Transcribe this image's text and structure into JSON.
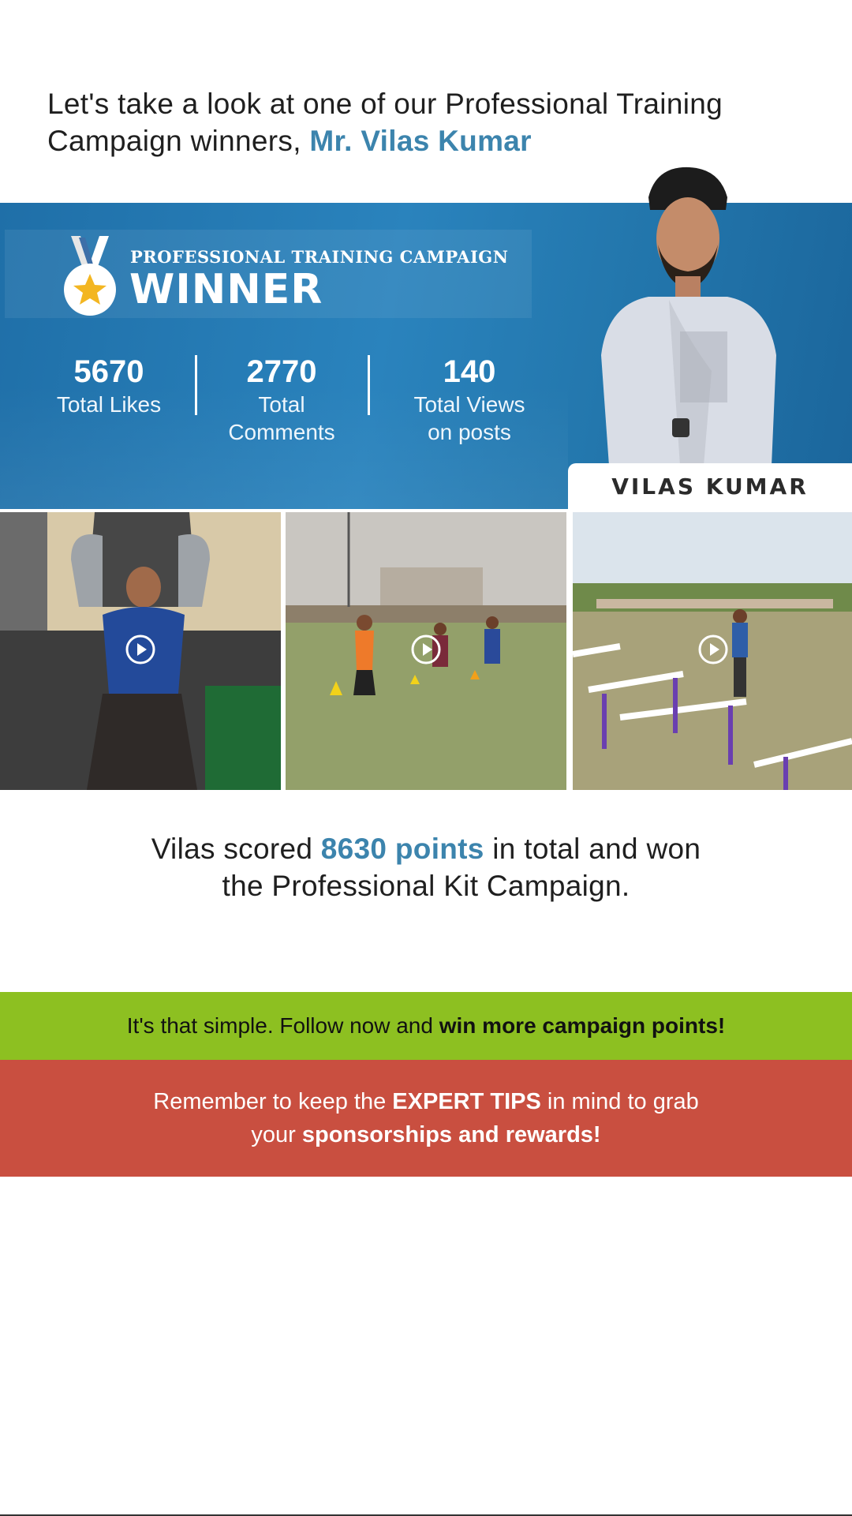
{
  "intro": {
    "text": "Let's take a look at one of our Professional Training Campaign winners,",
    "winner_name": "Mr. Vilas Kumar"
  },
  "banner": {
    "campaign_label": "PROFESSIONAL TRAINING CAMPAIGN",
    "winner_label": "WINNER",
    "medal_icon": "medal-star-icon",
    "stats": [
      {
        "value": "5670",
        "label_line1": "Total Likes",
        "label_line2": ""
      },
      {
        "value": "2770",
        "label_line1": "Total",
        "label_line2": "Comments"
      },
      {
        "value": "140",
        "label_line1": "Total Views",
        "label_line2": "on posts"
      }
    ],
    "name_tab": "VILAS KUMAR"
  },
  "gallery": {
    "videos": [
      {
        "name": "gym-chest-press-video",
        "icon": "play-icon"
      },
      {
        "name": "field-drill-video",
        "icon": "play-icon"
      },
      {
        "name": "hurdles-video",
        "icon": "play-icon"
      }
    ]
  },
  "summary": {
    "prefix": "Vilas scored",
    "points": "8630 points",
    "suffix_line1": "in total and won",
    "line2": "the Professional Kit Campaign."
  },
  "green_band": {
    "text": "It's that simple. Follow now and",
    "bold": "win more campaign points!"
  },
  "red_band": {
    "part1": "Remember to keep the",
    "bold1": "EXPERT TIPS",
    "part2": "in mind to grab",
    "part3": "your",
    "bold2": "sponsorships and rewards!"
  },
  "colors": {
    "accent_blue": "#3c84ad",
    "banner_blue": "#2a83bd",
    "green": "#8dc021",
    "red": "#c94f40"
  }
}
